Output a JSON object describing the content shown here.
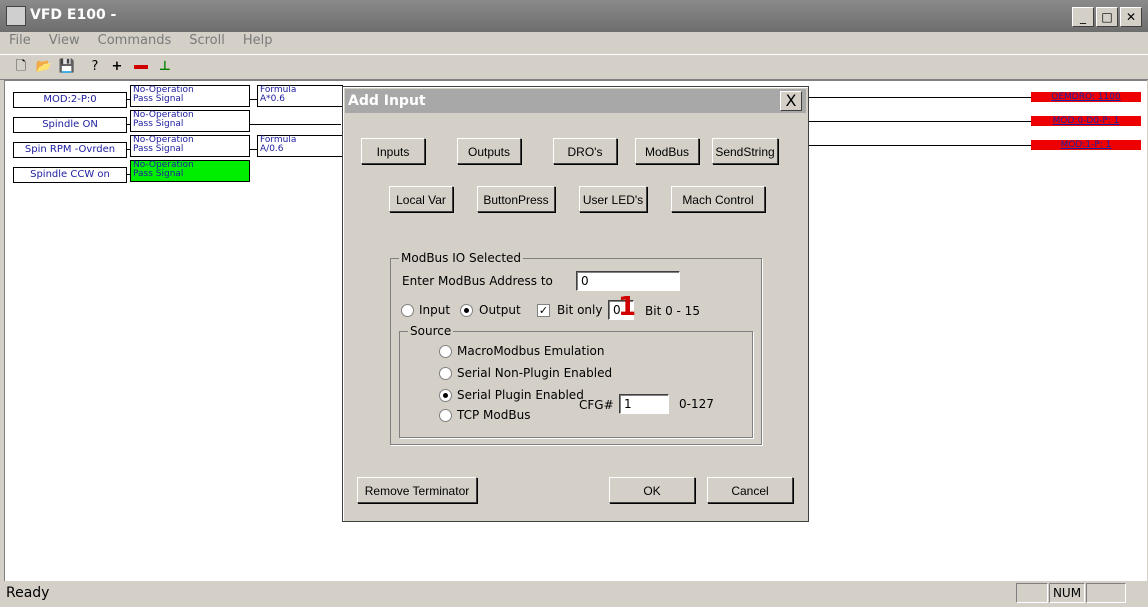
{
  "window": {
    "title": "VFD E100 -"
  },
  "menu": [
    "File",
    "View",
    "Commands",
    "Scroll",
    "Help"
  ],
  "ladder": {
    "rows": [
      {
        "input": "MOD:2-P:0",
        "op1": "No-Operation",
        "op2": "Pass Signal",
        "formula1": "Formula",
        "formula2": "A*0.6",
        "output": "OEMDRO: 1100"
      },
      {
        "input": "Spindle ON",
        "op1": "No-Operation",
        "op2": "Pass Signal",
        "output": "MOD:0-D0-P: 1"
      },
      {
        "input": "Spin RPM -Ovrden",
        "op1": "No-Operation",
        "op2": "Pass Signal",
        "formula1": "Formula",
        "formula2": "A/0.6",
        "output": "MOD:1-P: 1"
      },
      {
        "input": "Spindle CCW on",
        "op1": "No-Operation",
        "op2": "Pass Signal"
      }
    ]
  },
  "dialog": {
    "title": "Add Input",
    "close": "X",
    "buttons_row1": [
      "Inputs",
      "Outputs",
      "DRO's",
      "ModBus",
      "SendString"
    ],
    "buttons_row2": [
      "Local Var",
      "ButtonPress",
      "User LED's",
      "Mach Control"
    ],
    "modbus_group": {
      "label": "ModBus IO Selected",
      "address_label": "Enter ModBus Address to",
      "address_value": "0",
      "input_label": "Input",
      "output_label": "Output",
      "bitonly_label": "Bit only",
      "bit_value": "0",
      "bit_range": "Bit 0 - 15"
    },
    "source_group": {
      "label": "Source",
      "options": [
        "MacroModbus Emulation",
        "Serial Non-Plugin Enabled",
        "Serial Plugin Enabled",
        "TCP ModBus"
      ],
      "cfg_label": "CFG#",
      "cfg_value": "1",
      "cfg_range": "0-127"
    },
    "remove_label": "Remove Terminator",
    "ok_label": "OK",
    "cancel_label": "Cancel"
  },
  "status": {
    "text": "Ready",
    "num": "NUM"
  }
}
